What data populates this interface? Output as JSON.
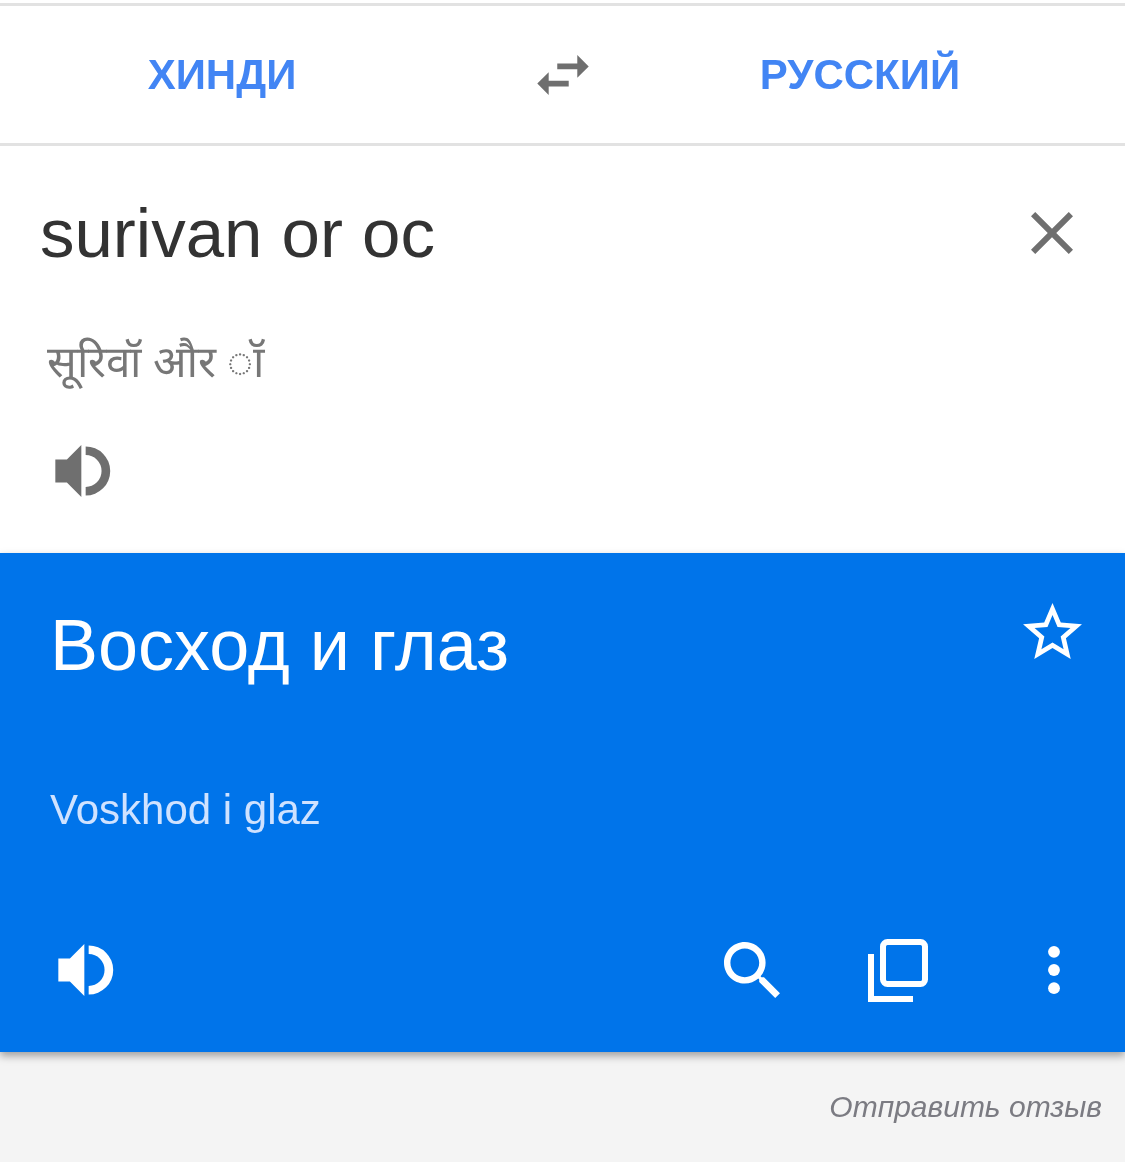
{
  "header": {
    "source_language": "ХИНДИ",
    "target_language": "РУССКИЙ"
  },
  "input": {
    "value": "surivan or oc",
    "transliteration": "सूरिवॉ और ॉ"
  },
  "result": {
    "translation": "Восход и глаз",
    "starred": false,
    "transliteration": "Voskhod i glaz"
  },
  "footer": {
    "feedback_link": "Отправить отзыв"
  }
}
